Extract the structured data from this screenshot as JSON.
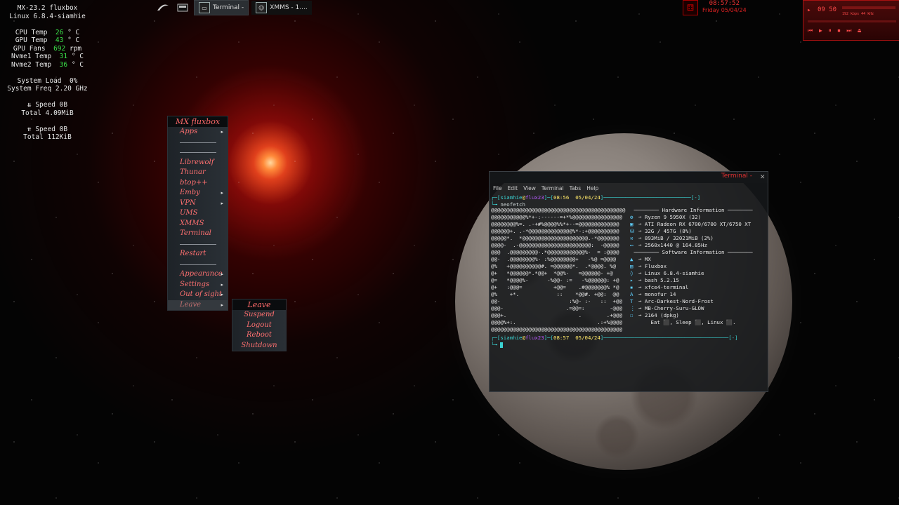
{
  "conky": {
    "os": "MX-23.2 fluxbox",
    "kernel": "Linux 6.8.4-siamhie",
    "cpu_temp_label": "CPU Temp",
    "cpu_temp_value": "26",
    "cpu_temp_unit": "° C",
    "gpu_temp_label": "GPU Temp",
    "gpu_temp_value": "43",
    "gpu_temp_unit": "° C",
    "gpu_fans_label": "GPU Fans",
    "gpu_fans_value": "692",
    "gpu_fans_unit": "rpm",
    "nvme1_label": "Nvme1 Temp",
    "nvme1_value": "31",
    "nvme1_unit": "° C",
    "nvme2_label": "Nvme2 Temp",
    "nvme2_value": "36",
    "nvme2_unit": "° C",
    "sys_load": "System Load  0%",
    "sys_freq": "System Freq 2.20 GHz",
    "down_speed": "⇊ Speed 0B",
    "down_total": "Total 4.09MiB",
    "up_speed": "⇈ Speed 0B",
    "up_total": "Total 112KiB"
  },
  "taskbar": {
    "tasks": [
      {
        "label": "Terminal -"
      },
      {
        "label": "XMMS - 1...."
      }
    ]
  },
  "clock": {
    "time": "08:57:52",
    "date": "Friday 05/04/24"
  },
  "xmms_widget": {
    "time": "09 50",
    "info": "192 kbps 44 kHz"
  },
  "menu": {
    "title": "MX fluxbox",
    "items": {
      "apps": "Apps",
      "librewolf": "Librewolf",
      "thunar": "Thunar",
      "btop": "btop++",
      "emby": "Emby",
      "vpn": "VPN",
      "ums": "UMS",
      "xmms": "XMMS",
      "terminal": "Terminal",
      "restart": "Restart",
      "appearance": "Appearance",
      "settings": "Settings",
      "out_of_sight": "Out of sight",
      "leave": "Leave"
    },
    "submenu": {
      "title": "Leave",
      "suspend": "Suspend",
      "logout": "Logout",
      "reboot": "Reboot",
      "shutdown": "Shutdown"
    }
  },
  "terminal": {
    "title": "Terminal -",
    "menus": [
      "File",
      "Edit",
      "View",
      "Terminal",
      "Tabs",
      "Help"
    ],
    "prompt1": {
      "user": "siamhie",
      "host": "flux23",
      "time": "08:56",
      "date": "05/04/24"
    },
    "command": "neofetch",
    "prompt2": {
      "user": "siamhie",
      "host": "flux23",
      "time": "08:57",
      "date": "05/04/24"
    },
    "hw_header": "Hardware Information",
    "hw": [
      {
        "icon": "⚙",
        "value": "Ryzen 9 5950X (32)"
      },
      {
        "icon": "▣",
        "value": "ATI Radeon RX 6700/6700 XT/6750 XT"
      },
      {
        "icon": "⛁",
        "value": "32G / 457G (8%)"
      },
      {
        "icon": "⚒",
        "value": "893MiB / 32021MiB (2%)"
      },
      {
        "icon": "▭",
        "value": "2560x1440 @ 164.85Hz"
      }
    ],
    "sw_header": "Software Information",
    "sw": [
      {
        "icon": "▲",
        "value": "MX"
      },
      {
        "icon": "▤",
        "value": "Fluxbox"
      },
      {
        "icon": "◊",
        "value": "Linux 6.8.4-siamhie"
      },
      {
        "icon": "▸",
        "value": "bash 5.2.15"
      },
      {
        "icon": "▪",
        "value": "xfce4-terminal"
      },
      {
        "icon": "A",
        "value": "monofur 14"
      },
      {
        "icon": "T",
        "value": "Arc-Darkest-Nord-Frost"
      },
      {
        "icon": "⋮",
        "value": "MB-Cherry-Suru-GLOW"
      },
      {
        "icon": "☐",
        "value": "2164 (dpkg)"
      }
    ],
    "footer": "Eat ⬛, Sleep ⬛, Linux ⬛.",
    "ascii": [
      "@@@@@@@@@@@@@@@@@@@@@@@@@@@@@@@@@@@@@@@@@@@",
      "@@@@@@@@@@@%*+-:------=+*%@@@@@@@@@@@@@@@@",
      "@@@@@@@@%=. .-+#%@@@@%%*+--=@@@@@@@@@@@@@",
      "@@@@@@+. .-*@@@@@@@@@@@@@@%*-:+@@@@@@@@@@",
      "@@@@@*.  *@@@@@@@@@@@@@@@@@@@@@.-*@@@@@@@",
      "@@@@-  .-@@@@@@@@@@@@@@@@@@@@@@@:  -@@@@@",
      "@@@  .@@@@@@@@@-.*@@@@@@@@@@@@%-  = :@@@@",
      "@@-  .@@@@@@@@%- :%@@@@@@@@+   -%@ =@@@@",
      "@%   +@@@@@@@@@@#. =@@@@@@*.  .*@@@@. %@",
      "@+   *@@@@@@*.*@@+  *@@%-   =@@@@@@- +@",
      "@=   *@@@@%-      -%@@- :=   -%@@@@@@: +@",
      "@+   :@@@=          +@@=    .#@@@@@@@% *@",
      "@%    +*.            ::    *@@#. +@@:  @@",
      "@@-                      :%@- :-   ::  +@@",
      "@@@-                    .=@@=:        -@@@",
      "@@@+.                       .        .+@@@",
      "@@@@%+:.                          .:+%@@@@",
      "@@@@@@@@@@@@@@@@@@@@@@@@@@@@@@@@@@@@@@@@@@"
    ]
  }
}
